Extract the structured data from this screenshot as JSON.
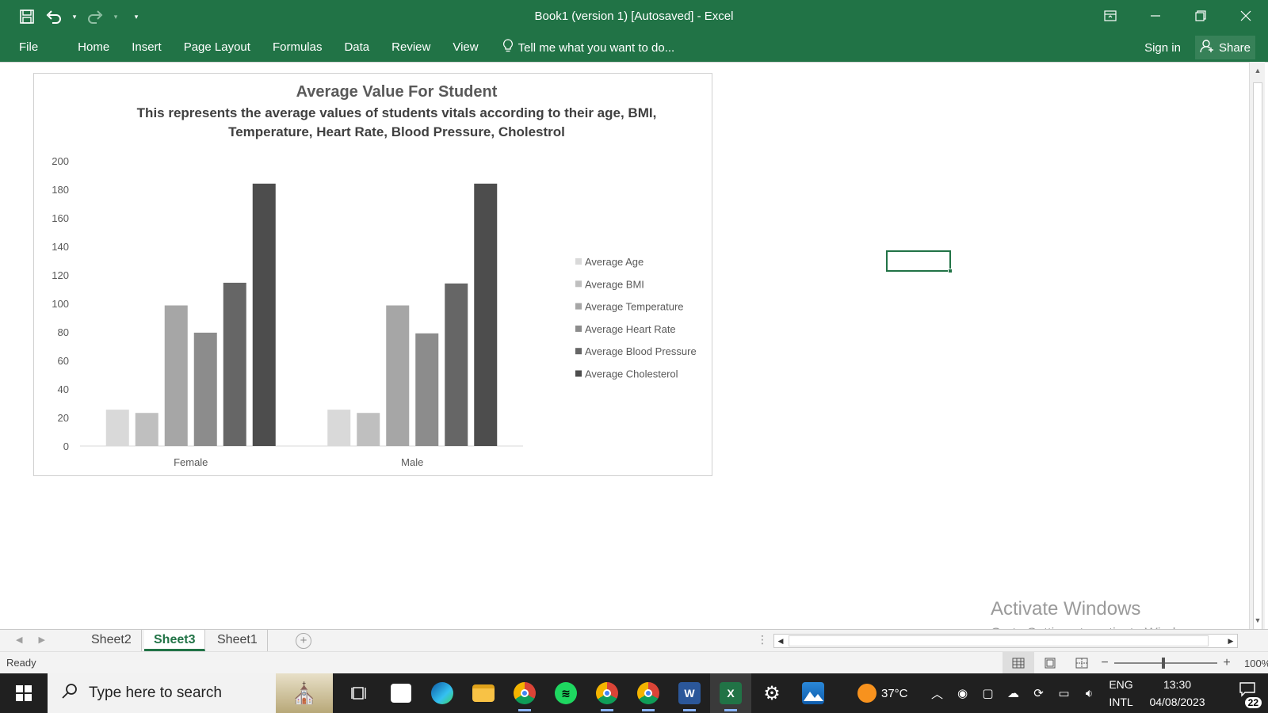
{
  "window": {
    "title": "Book1 (version 1) [Autosaved] - Excel",
    "accent": "#217346"
  },
  "qat": {
    "save_icon": "save-icon",
    "undo_icon": "undo-icon",
    "redo_icon": "redo-icon",
    "customize_icon": "chevron-down-icon"
  },
  "ribbon": {
    "tabs": [
      "File",
      "Home",
      "Insert",
      "Page Layout",
      "Formulas",
      "Data",
      "Review",
      "View"
    ],
    "tell_me": "Tell me what you want to do...",
    "sign_in": "Sign in",
    "share": "Share"
  },
  "chart_data": {
    "type": "bar",
    "title": "Average Value For Student",
    "subtitle": "This represents the average values of students vitals according to their age, BMI, Temperature, Heart Rate,  Blood Pressure, Cholestrol",
    "categories": [
      "Female",
      "Male"
    ],
    "series": [
      {
        "name": "Average Age",
        "values": [
          25.5,
          25.5
        ],
        "color": "#d9d9d9"
      },
      {
        "name": "Average BMI",
        "values": [
          23.2,
          23.2
        ],
        "color": "#bfbfbf"
      },
      {
        "name": "Average Temperature",
        "values": [
          98.6,
          98.6
        ],
        "color": "#a6a6a6"
      },
      {
        "name": "Average Heart Rate",
        "values": [
          79.5,
          79.0
        ],
        "color": "#8c8c8c"
      },
      {
        "name": "Average Blood Pressure",
        "values": [
          114.5,
          114.0
        ],
        "color": "#666666"
      },
      {
        "name": "Average Cholesterol",
        "values": [
          184,
          184
        ],
        "color": "#4d4d4d"
      }
    ],
    "yticks": [
      "0",
      "20",
      "40",
      "60",
      "80",
      "100",
      "120",
      "140",
      "160",
      "180",
      "200"
    ],
    "ylim": [
      0,
      200
    ],
    "xlabel": "",
    "ylabel": "",
    "grid": false,
    "legend_position": "right"
  },
  "watermark": {
    "line1": "Activate Windows",
    "line2": "Go to Settings to activate Windows."
  },
  "sheets": {
    "tabs": [
      "Sheet2",
      "Sheet3",
      "Sheet1"
    ],
    "active": "Sheet3"
  },
  "status": {
    "ready": "Ready",
    "zoom": "100%"
  },
  "taskbar": {
    "search_placeholder": "Type here to search",
    "apps": [
      "task-view-icon",
      "microsoft-store-icon",
      "edge-icon",
      "file-explorer-icon",
      "chrome-icon",
      "spotify-icon",
      "chrome-profile-icon",
      "chrome-icon",
      "word-icon",
      "excel-icon",
      "settings-icon",
      "photos-icon"
    ],
    "weather": "37°C",
    "lang_line1": "ENG",
    "lang_line2": "INTL",
    "time": "13:30",
    "date": "04/08/2023",
    "notifications": "22"
  }
}
